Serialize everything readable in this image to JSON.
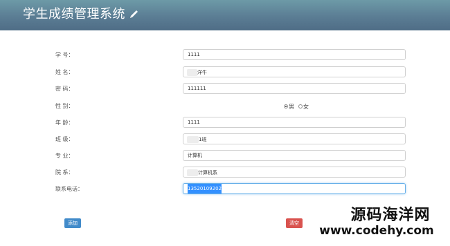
{
  "header": {
    "title": "学生成绩管理系统",
    "icon": "pencil-icon",
    "colors": {
      "top": "#6d9aa7",
      "bottom": "#4f6d86"
    }
  },
  "form": {
    "fields": [
      {
        "key": "student_id",
        "label": "学   号：",
        "value": "1111"
      },
      {
        "key": "name",
        "label": "姓   名：",
        "value": "洋牛"
      },
      {
        "key": "password",
        "label": "密   码：",
        "value": "111111"
      },
      {
        "key": "gender",
        "label": "性   别：",
        "options": [
          "男",
          "女"
        ],
        "selected": "男"
      },
      {
        "key": "age",
        "label": "年   龄：",
        "value": "1111"
      },
      {
        "key": "class",
        "label": "班   级：",
        "value": "1班"
      },
      {
        "key": "major",
        "label": "专   业：",
        "value": "计算机"
      },
      {
        "key": "department",
        "label": "院   系：",
        "value": "计算机系"
      },
      {
        "key": "phone",
        "label": "联系电话：",
        "value": "13520109202"
      }
    ]
  },
  "buttons": {
    "add_label": "添加",
    "clear_label": "清空",
    "add_color": "#428bca",
    "clear_color": "#d9534f"
  },
  "watermark": {
    "line1": "源码海洋网",
    "line2": "www.codehy.com"
  }
}
